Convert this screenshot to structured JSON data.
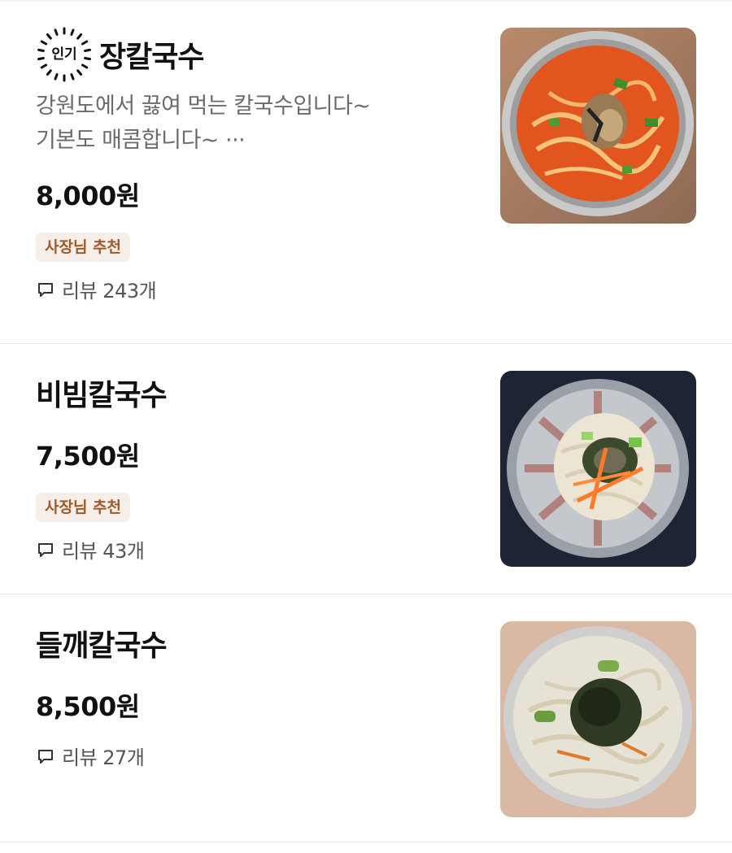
{
  "menu": {
    "items": [
      {
        "name": "장칼국수",
        "popular_label": "인기",
        "description": "강원도에서 끓여 먹는 칼국수입니다~\n기본도 매콤합니다~ ···",
        "description_line1": "강원도에서 끓여 먹는 칼국수입니다~",
        "description_line2": "기본도 매콤합니다~ ···",
        "price": "8,000원",
        "badge": "사장님 추천",
        "review": "리뷰 243개",
        "image_icon": "spicy-noodle-soup-photo"
      },
      {
        "name": "비빔칼국수",
        "price": "7,500원",
        "badge": "사장님 추천",
        "review": "리뷰 43개",
        "image_icon": "mixed-noodle-photo"
      },
      {
        "name": "들깨칼국수",
        "price": "8,500원",
        "review": "리뷰 27개",
        "image_icon": "perilla-noodle-soup-photo"
      }
    ],
    "colors": {
      "badge_bg": "#f6eee7",
      "badge_text": "#9c5b2d",
      "description": "#6b6b6b"
    },
    "icons": {
      "review": "speech-bubble-icon",
      "popular": "sunburst-badge-icon"
    }
  }
}
